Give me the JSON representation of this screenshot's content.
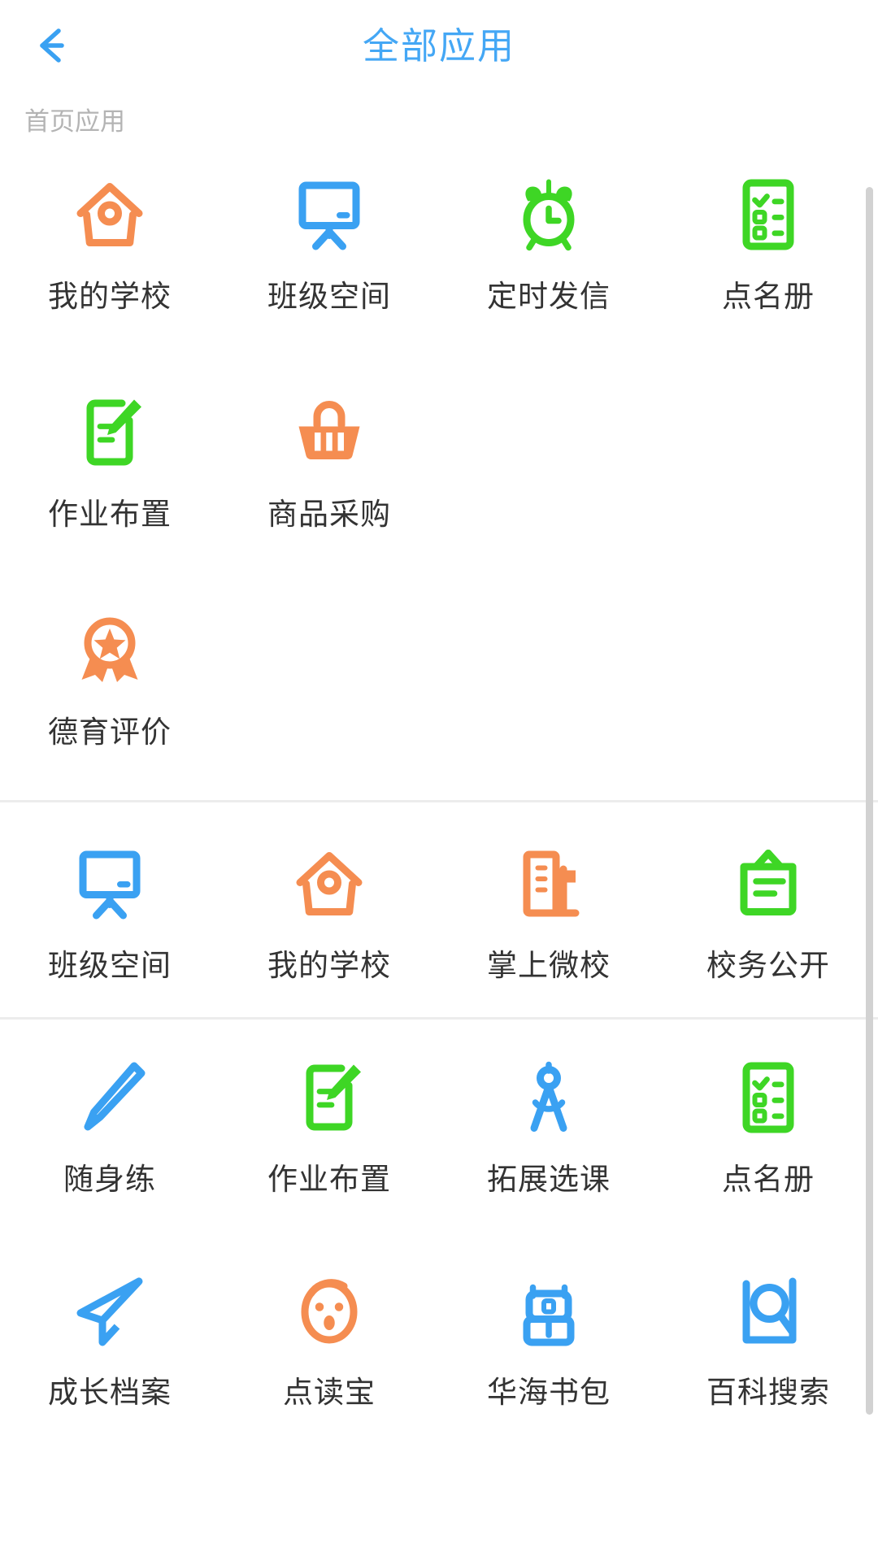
{
  "header": {
    "title": "全部应用",
    "back_icon": "back-arrow-icon"
  },
  "sections": [
    {
      "title": "首页应用",
      "apps": [
        {
          "label": "我的学校",
          "icon": "house-icon",
          "color": "#f58d51"
        },
        {
          "label": "班级空间",
          "icon": "whiteboard-icon",
          "color": "#3aa1f2"
        },
        {
          "label": "定时发信",
          "icon": "alarm-clock-icon",
          "color": "#3ed625"
        },
        {
          "label": "点名册",
          "icon": "checklist-icon",
          "color": "#3ed625"
        },
        {
          "label": "作业布置",
          "icon": "note-pencil-icon",
          "color": "#3ed625"
        },
        {
          "label": "商品采购",
          "icon": "basket-icon",
          "color": "#f58d51"
        },
        {
          "label": "",
          "icon": "",
          "color": ""
        },
        {
          "label": "",
          "icon": "",
          "color": ""
        },
        {
          "label": "德育评价",
          "icon": "medal-star-icon",
          "color": "#f58d51"
        }
      ]
    },
    {
      "title": "",
      "apps": [
        {
          "label": "班级空间",
          "icon": "whiteboard-icon",
          "color": "#3aa1f2"
        },
        {
          "label": "我的学校",
          "icon": "house-icon",
          "color": "#f58d51"
        },
        {
          "label": "掌上微校",
          "icon": "building-flag-icon",
          "color": "#f58d51"
        },
        {
          "label": "校务公开",
          "icon": "noticeboard-icon",
          "color": "#3ed625"
        }
      ]
    },
    {
      "title": "",
      "apps": [
        {
          "label": "随身练",
          "icon": "pen-icon",
          "color": "#3aa1f2"
        },
        {
          "label": "作业布置",
          "icon": "note-pencil-icon",
          "color": "#3ed625"
        },
        {
          "label": "拓展选课",
          "icon": "compass-icon",
          "color": "#3aa1f2"
        },
        {
          "label": "点名册",
          "icon": "checklist-icon",
          "color": "#3ed625"
        },
        {
          "label": "成长档案",
          "icon": "paper-plane-icon",
          "color": "#3aa1f2"
        },
        {
          "label": "点读宝",
          "icon": "face-icon",
          "color": "#f58d51"
        },
        {
          "label": "华海书包",
          "icon": "backpack-icon",
          "color": "#3aa1f2"
        },
        {
          "label": "百科搜索",
          "icon": "search-page-icon",
          "color": "#3aa1f2"
        }
      ]
    }
  ],
  "colors": {
    "accent_blue": "#44a7f5",
    "icon_blue": "#3aa1f2",
    "icon_green": "#3ed625",
    "icon_orange": "#f58d51",
    "label_text": "#333333",
    "section_title": "#b4b4b4",
    "divider": "#ececec",
    "scrollbar": "#d2d2d2"
  }
}
